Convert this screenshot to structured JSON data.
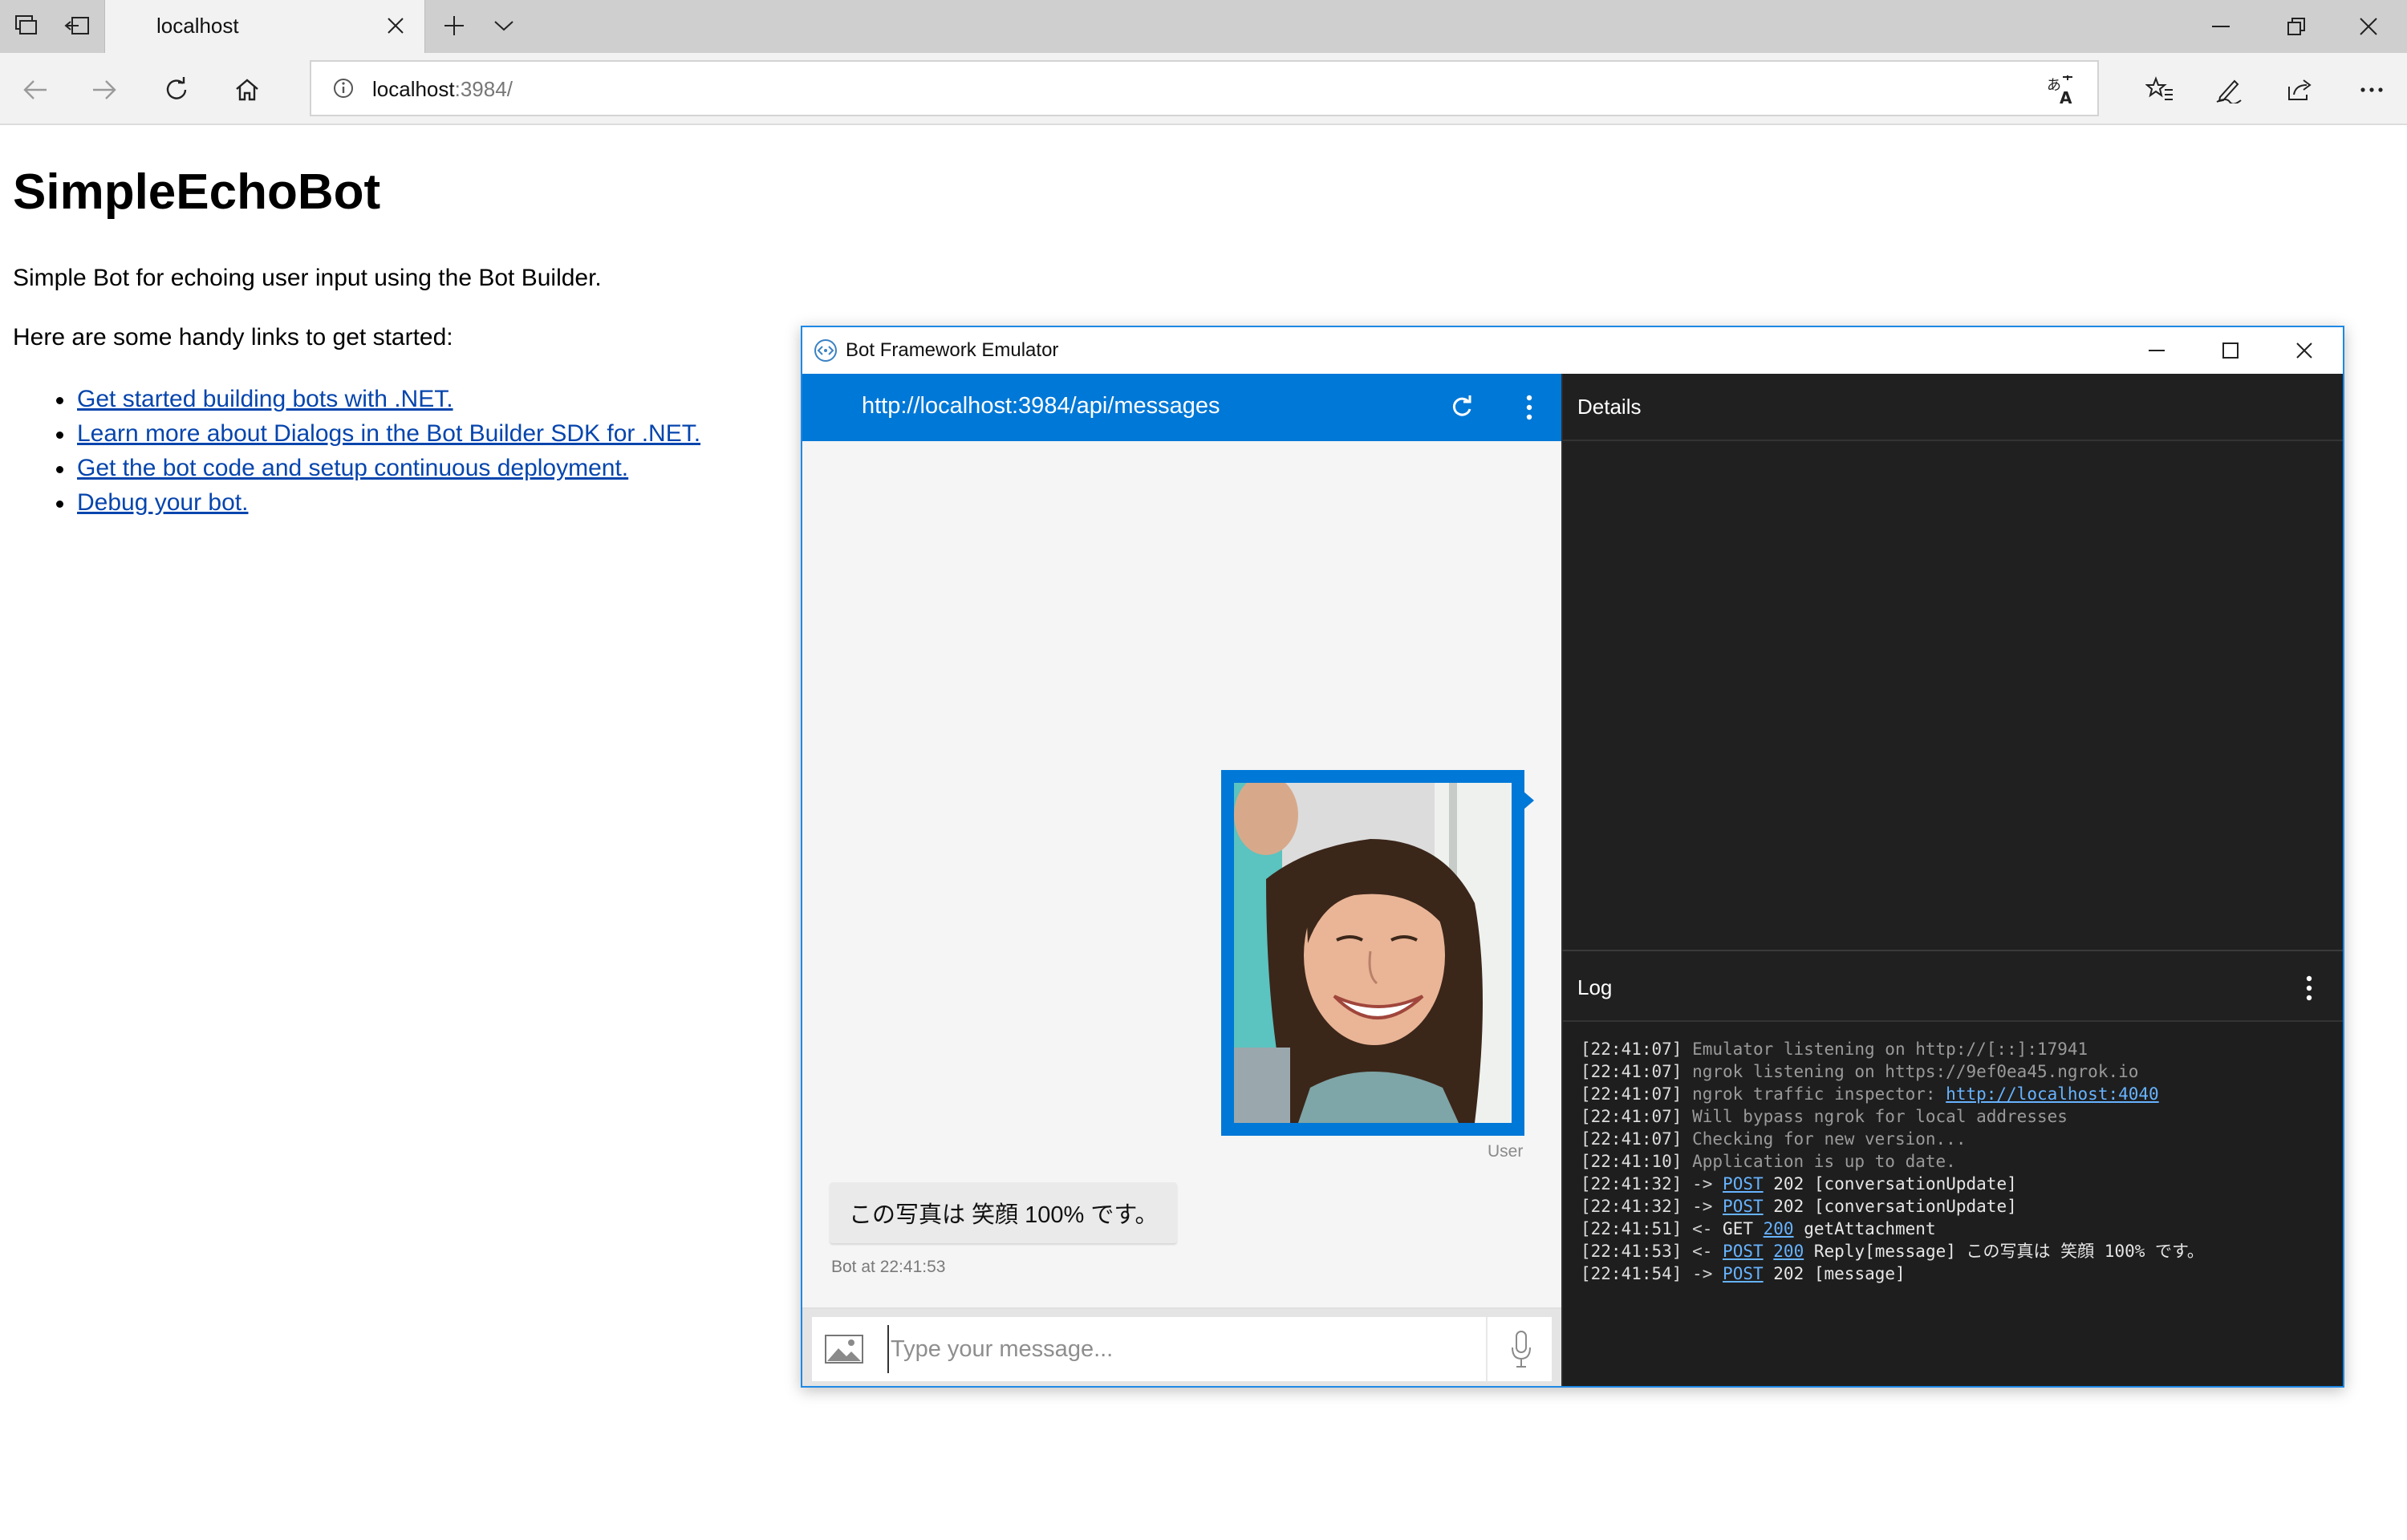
{
  "browser": {
    "tab_title": "localhost",
    "address_host": "localhost",
    "address_path": ":3984/"
  },
  "page": {
    "title": "SimpleEchoBot",
    "description": "Simple Bot for echoing user input using the Bot Builder.",
    "intro": "Here are some handy links to get started:",
    "links": [
      "Get started building bots with .NET.",
      "Learn more about Dialogs in the Bot Builder SDK for .NET.",
      "Get the bot code and setup continuous deployment.",
      "Debug your bot."
    ]
  },
  "emulator": {
    "title": "Bot Framework Emulator",
    "endpoint_url": "http://localhost:3984/api/messages",
    "user_label": "User",
    "bot_message": "この写真は 笑顔 100% です。",
    "bot_label": "Bot at 22:41:53",
    "input_placeholder": "Type your message...",
    "details_title": "Details",
    "log_title": "Log",
    "log": [
      {
        "time": "[22:41:07]",
        "msg": "Emulator listening on http://[::]:17941"
      },
      {
        "time": "[22:41:07]",
        "msg": "ngrok listening on https://9ef0ea45.ngrok.io"
      },
      {
        "time": "[22:41:07]",
        "msg": "ngrok traffic inspector: ",
        "link": "http://localhost:4040"
      },
      {
        "time": "[22:41:07]",
        "msg": "Will bypass ngrok for local addresses"
      },
      {
        "time": "[22:41:07]",
        "msg": "Checking for new version..."
      },
      {
        "time": "[22:41:10]",
        "msg": "Application is up to date."
      },
      {
        "time": "[22:41:32]",
        "dir": "->",
        "verb": "POST",
        "status": "202",
        "status_link": false,
        "rest": "[conversationUpdate]"
      },
      {
        "time": "[22:41:32]",
        "dir": "->",
        "verb": "POST",
        "status": "202",
        "status_link": false,
        "rest": "[conversationUpdate]"
      },
      {
        "time": "[22:41:51]",
        "dir": "<-",
        "verb": "GET",
        "verb_link": false,
        "status": "200",
        "status_link": true,
        "rest": "getAttachment"
      },
      {
        "time": "[22:41:53]",
        "dir": "<-",
        "verb": "POST",
        "status": "200",
        "status_link": true,
        "rest": "Reply[message] この写真は 笑顔 100% です。"
      },
      {
        "time": "[22:41:54]",
        "dir": "->",
        "verb": "POST",
        "status": "202",
        "status_link": false,
        "rest": "[message]"
      }
    ]
  },
  "colors": {
    "accent": "#0078d7",
    "link": "#0645ad",
    "log_link": "#67b3ff",
    "dark_panel": "#1e1e1e"
  }
}
